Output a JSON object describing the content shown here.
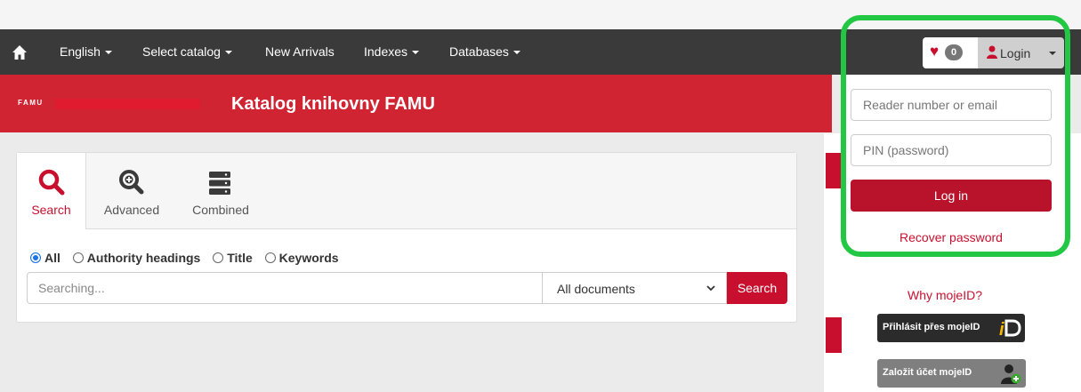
{
  "colors": {
    "brand_red": "#c8102e",
    "navbar": "#3a3a3a",
    "highlight_green": "#22c744"
  },
  "navbar": {
    "home_icon": "home-icon",
    "items": [
      {
        "label": "English",
        "dropdown": true
      },
      {
        "label": "Select catalog",
        "dropdown": true
      },
      {
        "label": "New Arrivals",
        "dropdown": false
      },
      {
        "label": "Indexes",
        "dropdown": true
      },
      {
        "label": "Databases",
        "dropdown": true
      }
    ],
    "favorites": {
      "icon": "heart-icon",
      "count": "0"
    },
    "login": {
      "icon": "user-icon",
      "label": "Login"
    }
  },
  "header": {
    "logo_text": "FAMU",
    "title": "Katalog knihovny FAMU"
  },
  "search": {
    "tabs": [
      {
        "label": "Search",
        "icon": "search-icon",
        "active": true
      },
      {
        "label": "Advanced",
        "icon": "zoom-plus-icon",
        "active": false
      },
      {
        "label": "Combined",
        "icon": "server-stack-icon",
        "active": false
      }
    ],
    "scope": [
      {
        "label": "All",
        "checked": true
      },
      {
        "label": "Authority headings",
        "checked": false
      },
      {
        "label": "Title",
        "checked": false
      },
      {
        "label": "Keywords",
        "checked": false
      }
    ],
    "input_placeholder": "Searching...",
    "doc_type": "All documents",
    "button": "Search"
  },
  "login_panel": {
    "reader_placeholder": "Reader number or email",
    "pin_placeholder": "PIN (password)",
    "submit": "Log in",
    "recover": "Recover password"
  },
  "mojeid": {
    "why": "Why mojeID?",
    "login_button": "Přihlásit přes mojeID",
    "create_button": "Založit účet mojeID"
  }
}
